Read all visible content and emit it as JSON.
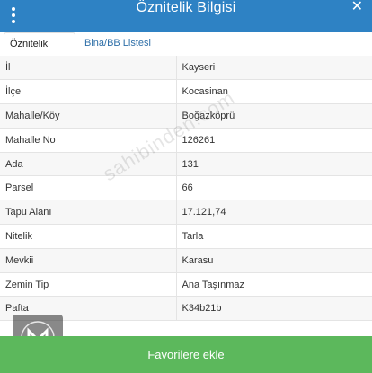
{
  "header": {
    "title": "Öznitelik Bilgisi",
    "menu_icon": "kebab-menu-icon",
    "close_icon": "close-icon",
    "close_glyph": "✕",
    "color": "#2e82c4"
  },
  "tabs": [
    {
      "label": "Öznitelik Bilgisi",
      "active": true
    },
    {
      "label": "Bina/BB Listesi",
      "active": false
    }
  ],
  "attributes": [
    {
      "key": "İl",
      "value": "Kayseri"
    },
    {
      "key": "İlçe",
      "value": "Kocasinan"
    },
    {
      "key": "Mahalle/Köy",
      "value": "Boğazköprü"
    },
    {
      "key": "Mahalle No",
      "value": "126261"
    },
    {
      "key": "Ada",
      "value": "131"
    },
    {
      "key": "Parsel",
      "value": "66"
    },
    {
      "key": "Tapu Alanı",
      "value": "17.121,74"
    },
    {
      "key": "Nitelik",
      "value": "Tarla"
    },
    {
      "key": "Mevkii",
      "value": "Karasu"
    },
    {
      "key": "Zemin Tip",
      "value": "Ana Taşınmaz"
    },
    {
      "key": "Pafta",
      "value": "K34b21b"
    }
  ],
  "favorite_button": {
    "label": "Favorilere ekle",
    "color": "#5cb85c"
  },
  "watermark": "sahibinden.com"
}
